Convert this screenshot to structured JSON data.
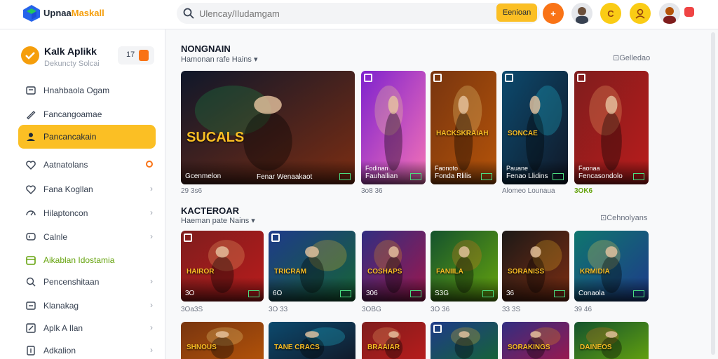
{
  "topbar": {
    "brand_a": "Upnaa",
    "brand_b": "Maskall",
    "search_placeholder": "Ulencay/Iludamgam",
    "search_button": "Eenioan",
    "colors": {
      "accent": "#fbbf24",
      "orange": "#f97316",
      "yellow": "#facc15"
    }
  },
  "sidebar": {
    "profile": {
      "name": "Kalk Aplikk",
      "sub": "Dekuncty Solcai",
      "badge": "17"
    },
    "items": [
      {
        "label": "Hnahbaola Ogam",
        "icon": "image-icon",
        "chev": ""
      },
      {
        "label": "Fancangoamae",
        "icon": "pen-icon",
        "chev": ""
      },
      {
        "label": "Pancancakain",
        "icon": "user-icon",
        "chev": ""
      },
      {
        "label": "Aatnatolans",
        "icon": "heart-icon",
        "chev": ""
      },
      {
        "label": "Fana Kogllan",
        "icon": "heart-icon",
        "chev": "›"
      },
      {
        "label": "Hilaptoncon",
        "icon": "gauge-icon",
        "chev": "›"
      },
      {
        "label": "Calnle",
        "icon": "chat-icon",
        "chev": "›"
      },
      {
        "label": "Aikablan Idostamia",
        "icon": "calendar-icon",
        "chev": ""
      },
      {
        "label": "Pencenshitaan",
        "icon": "search-icon",
        "chev": "›"
      },
      {
        "label": "Klanakag",
        "icon": "list-icon",
        "chev": "›"
      },
      {
        "label": "Aplk A Ilan",
        "icon": "edit-icon",
        "chev": "›"
      },
      {
        "label": "Adkalion",
        "icon": "doc-icon",
        "chev": "›"
      }
    ]
  },
  "section1": {
    "title": "NONGNAIN",
    "subtitle": "Hamonan rafe Hains",
    "link": "Gelledao",
    "cards": [
      {
        "cap": "Gcenmelon",
        "cap2": "",
        "big": "SUCALS",
        "extra": "Fenar Wenaakaot",
        "stat": "29 3s6"
      },
      {
        "cap": "Fauhallian",
        "cap2": "Fodinan",
        "big": "",
        "stat": "3o8 36"
      },
      {
        "cap": "Fonda Rlilis",
        "cap2": "Faonoto",
        "big": "HACKSKRAIAH",
        "stat": ""
      },
      {
        "cap": "Fenao Llidins",
        "cap2": "Pauane",
        "big": "SONCAE",
        "stat": "Alomeo Lounaua"
      },
      {
        "cap": "Fencasondolo",
        "cap2": "Faonaa",
        "big": "",
        "stat": "3OK6"
      }
    ]
  },
  "section2": {
    "title": "KACTEROAR",
    "subtitle": "Haeman pate Nains",
    "link": "Cehnolyans",
    "cards": [
      {
        "cap": "3O",
        "big": "HAIROR",
        "stat": "3Oa3S"
      },
      {
        "cap": "6O",
        "big": "TRICRAM",
        "stat": "3O 33"
      },
      {
        "cap": "306",
        "big": "COSHAPS",
        "stat": "3OBG"
      },
      {
        "cap": "S3G",
        "big": "FANIILA",
        "stat": "3O 36"
      },
      {
        "cap": "36",
        "big": "SORANISS",
        "stat": "33 3S"
      },
      {
        "cap": "Conaola",
        "big": "KRMIDIA",
        "stat": "39 46"
      }
    ]
  },
  "section3": {
    "cards": [
      {
        "big": "SHNOUS"
      },
      {
        "big": "TANE CRACS"
      },
      {
        "big": "BRAAIAR"
      },
      {
        "big": ""
      },
      {
        "big": "SORAKINGS"
      },
      {
        "big": "DAINEOS"
      }
    ]
  }
}
